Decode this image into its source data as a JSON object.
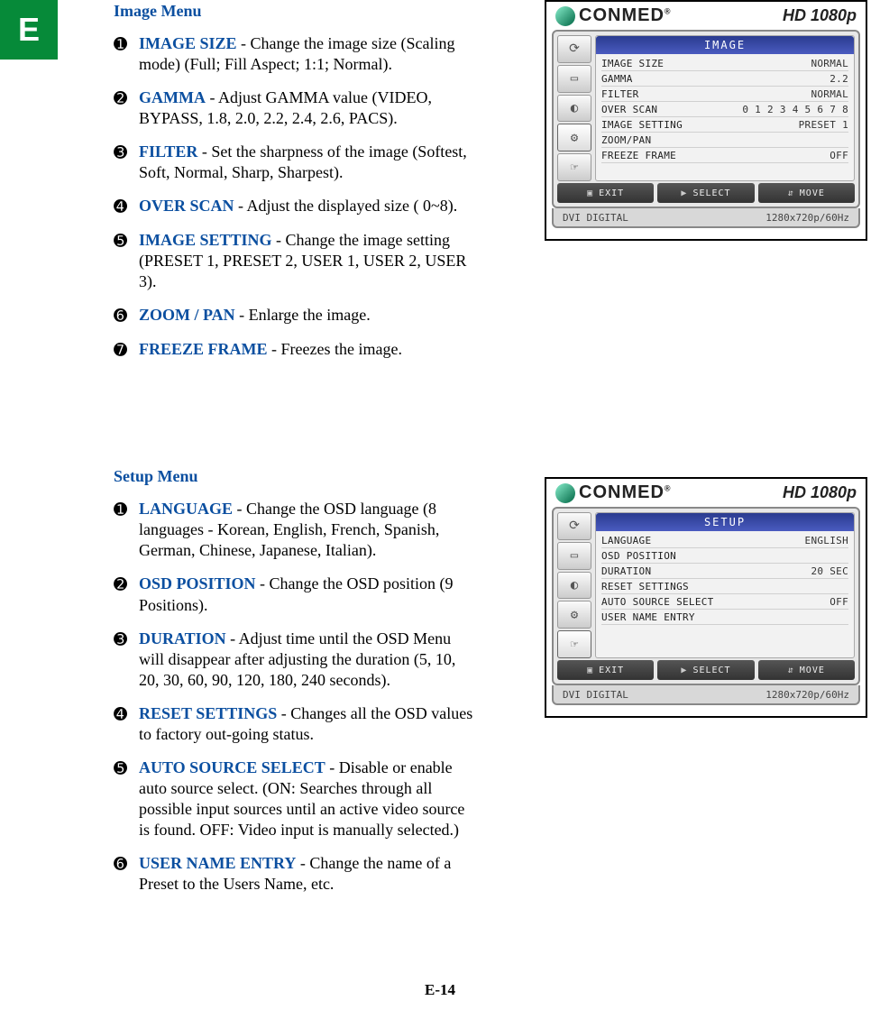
{
  "sideTab": "E",
  "pageNumber": "E-14",
  "sections": [
    {
      "title": "Image Menu",
      "items": [
        {
          "n": "➊",
          "term": "IMAGE SIZE",
          "desc": " - Change the image size (Scaling mode) (Full; Fill Aspect; 1:1; Normal)."
        },
        {
          "n": "➋",
          "term": "GAMMA",
          "desc": " - Adjust GAMMA value (VIDEO, BYPASS, 1.8, 2.0, 2.2, 2.4, 2.6, PACS)."
        },
        {
          "n": "➌",
          "term": "FILTER",
          "desc": " - Set the sharpness of the image (Softest, Soft, Normal, Sharp, Sharpest)."
        },
        {
          "n": "➍",
          "term": "OVER SCAN",
          "desc": " - Adjust the displayed size ( 0~8)."
        },
        {
          "n": "➎",
          "term": "IMAGE SETTING",
          "desc": " - Change the image setting (PRESET 1, PRESET 2, USER 1, USER 2, USER 3)."
        },
        {
          "n": "➏",
          "term": "ZOOM / PAN",
          "desc": " - Enlarge the image."
        },
        {
          "n": "➐",
          "term": "FREEZE FRAME",
          "desc": " - Freezes the image."
        }
      ]
    },
    {
      "title": "Setup Menu",
      "items": [
        {
          "n": "➊",
          "term": "LANGUAGE",
          "desc": " - Change the OSD language (8 languages - Korean, English, French, Spanish, German, Chinese, Japanese, Italian)."
        },
        {
          "n": "➋",
          "term": "OSD POSITION",
          "desc": " - Change the OSD position (9 Positions)."
        },
        {
          "n": "➌",
          "term": "DURATION",
          "desc": " - Adjust time until the OSD Menu will disappear after adjusting the duration (5, 10, 20, 30, 60, 90, 120, 180, 240 seconds)."
        },
        {
          "n": "➍",
          "term": "RESET SETTINGS",
          "desc": " - Changes all the OSD values to factory out-going status."
        },
        {
          "n": "➎",
          "term": "AUTO SOURCE SELECT",
          "desc": " - Disable or enable auto source select. (ON: Searches through all possible input sources until an active video source is found. OFF: Video input is manually selected.)"
        },
        {
          "n": "➏",
          "term": "USER NAME ENTRY",
          "desc": " - Change the name of a Preset to the Users Name, etc."
        }
      ]
    }
  ],
  "osd": {
    "brand": "CONMED",
    "brandReg": "®",
    "model": "HD 1080p",
    "nav": {
      "exit": "EXIT",
      "select": "SELECT",
      "move": "MOVE"
    },
    "status": {
      "source": "DVI DIGITAL",
      "mode": "1280x720p/60Hz"
    },
    "tabIcons": [
      "⟳",
      "▭",
      "◐",
      "⚙",
      "☞"
    ],
    "panels": [
      {
        "title": "IMAGE",
        "activeTab": 3,
        "rows": [
          {
            "k": "IMAGE SIZE",
            "v": "NORMAL"
          },
          {
            "k": "GAMMA",
            "v": "2.2"
          },
          {
            "k": "FILTER",
            "v": "NORMAL"
          },
          {
            "k": "OVER SCAN",
            "v": "0 1 2 3 4 5 6 7 8"
          },
          {
            "k": "IMAGE SETTING",
            "v": "PRESET 1"
          },
          {
            "k": "ZOOM/PAN",
            "v": ""
          },
          {
            "k": "FREEZE FRAME",
            "v": "OFF"
          }
        ]
      },
      {
        "title": "SETUP",
        "activeTab": 4,
        "rows": [
          {
            "k": "LANGUAGE",
            "v": "ENGLISH"
          },
          {
            "k": "OSD POSITION",
            "v": ""
          },
          {
            "k": "DURATION",
            "v": "20 SEC"
          },
          {
            "k": "RESET SETTINGS",
            "v": ""
          },
          {
            "k": "AUTO SOURCE SELECT",
            "v": "OFF"
          },
          {
            "k": "USER NAME ENTRY",
            "v": ""
          }
        ]
      }
    ]
  }
}
